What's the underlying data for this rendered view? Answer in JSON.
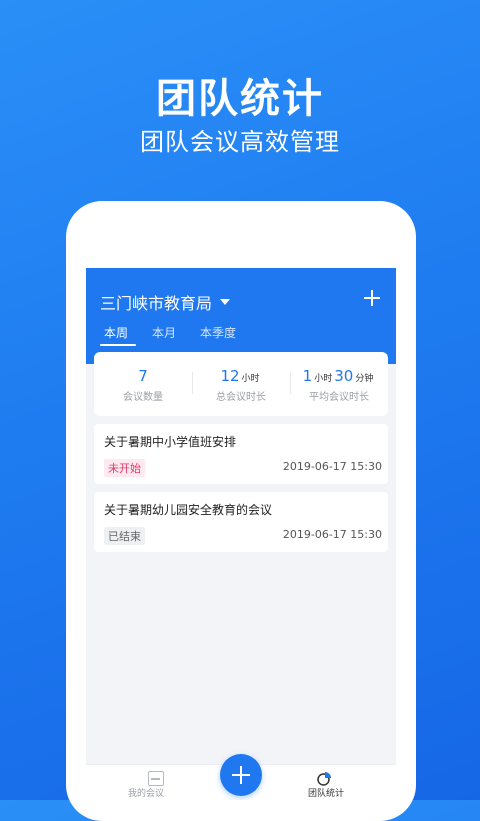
{
  "promo": {
    "title": "团队统计",
    "subtitle": "团队会议高效管理"
  },
  "app": {
    "org_name": "三门峡市教育局",
    "tabs": [
      {
        "label": "本周",
        "active": true
      },
      {
        "label": "本月",
        "active": false
      },
      {
        "label": "本季度",
        "active": false
      }
    ],
    "stats": {
      "count_value": "7",
      "count_label": "会议数量",
      "total_value": "12",
      "total_unit": "小时",
      "total_label": "总会议时长",
      "avg_hours": "1",
      "avg_hours_unit": "小时",
      "avg_minutes": "30",
      "avg_minutes_unit": "分钟",
      "avg_label": "平均会议时长"
    },
    "meetings": [
      {
        "title": "关于暑期中小学值班安排",
        "status": "未开始",
        "time": "2019-06-17 15:30"
      },
      {
        "title": "关于暑期幼儿园安全教育的会议",
        "status": "已结束",
        "time": "2019-06-17 15:30"
      }
    ],
    "nav": {
      "my_meetings": "我的会议",
      "team_stats": "团队统计"
    }
  },
  "colors": {
    "accent": "#1f78f0",
    "pending": "#e23a6a"
  }
}
